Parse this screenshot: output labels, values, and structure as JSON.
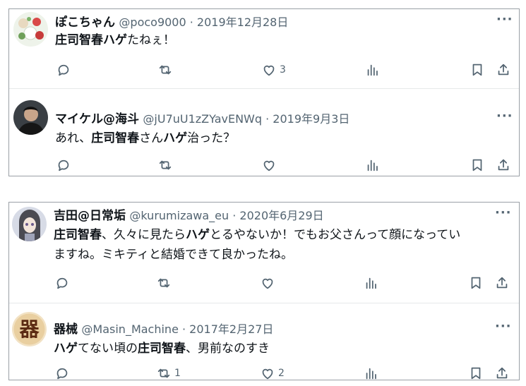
{
  "tweets": [
    {
      "name": "ぽこちゃん",
      "meta": "@poco9000 · 2019年12月28日",
      "body": [
        {
          "t": "庄司智春ハゲ",
          "b": true
        },
        {
          "t": "たねぇ！",
          "b": false
        }
      ],
      "reply_count": "",
      "retweet_count": "",
      "like_count": "3"
    },
    {
      "name": "マイケル@海斗",
      "meta": "@jU7uU1zZYavENWq · 2019年9月3日",
      "body": [
        {
          "t": "あれ、",
          "b": false
        },
        {
          "t": "庄司智春",
          "b": true
        },
        {
          "t": "さん",
          "b": false
        },
        {
          "t": "ハゲ",
          "b": true
        },
        {
          "t": "治った？",
          "b": false
        }
      ],
      "reply_count": "",
      "retweet_count": "",
      "like_count": ""
    },
    {
      "name": "吉田@日常垢",
      "meta": "@kurumizawa_eu · 2020年6月29日",
      "body": [
        {
          "t": "庄司智春",
          "b": true
        },
        {
          "t": "、久々に見たら",
          "b": false
        },
        {
          "t": "ハゲ",
          "b": true
        },
        {
          "t": "とるやないか！でもお父さんって顔になってい",
          "b": false
        }
      ],
      "body2": "ますね。ミキティと結婚できて良かったね。",
      "reply_count": "",
      "retweet_count": "",
      "like_count": ""
    },
    {
      "name": "器械",
      "meta": "@Masin_Machine · 2017年2月27日",
      "body": [
        {
          "t": "ハゲ",
          "b": true
        },
        {
          "t": "てない頃の",
          "b": false
        },
        {
          "t": "庄司智春",
          "b": true
        },
        {
          "t": "、男前なのすき",
          "b": false
        }
      ],
      "reply_count": "",
      "retweet_count": "1",
      "like_count": "2"
    }
  ],
  "icons": {
    "reply": "reply-icon",
    "retweet": "retweet-icon",
    "like": "heart-icon",
    "views": "views-icon",
    "bookmark": "bookmark-icon",
    "share": "share-icon",
    "more": "more-icon"
  },
  "colors": {
    "text": "#0f1419",
    "muted": "#536471",
    "border": "#9aa0a6"
  }
}
